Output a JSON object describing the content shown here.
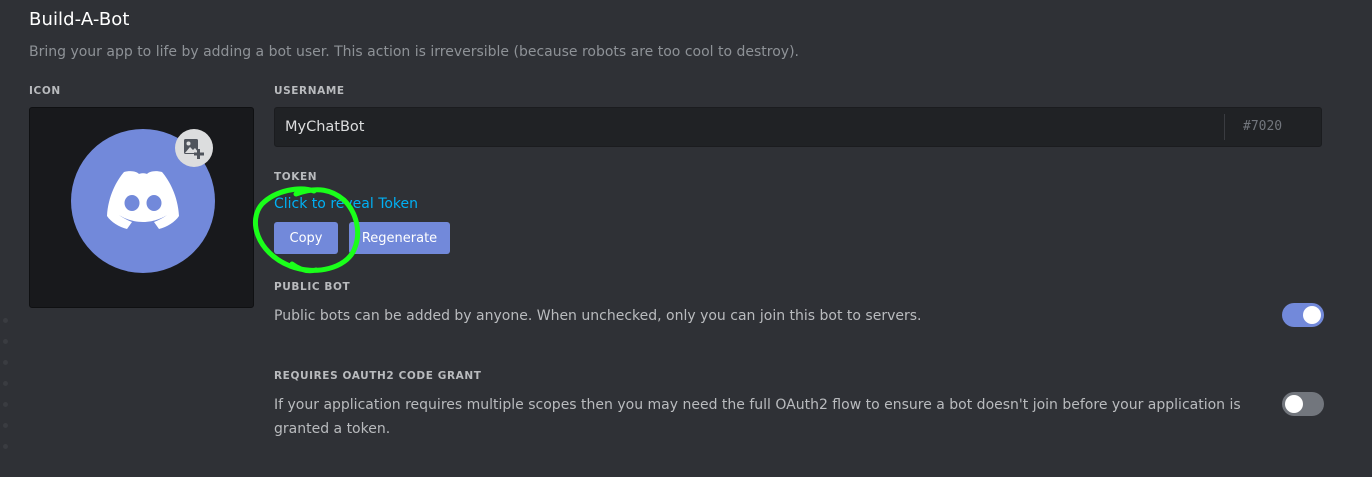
{
  "section": {
    "title": "Build-A-Bot",
    "subtitle": "Bring your app to life by adding a bot user. This action is irreversible (because robots are too cool to destroy)."
  },
  "icon": {
    "label": "ICON",
    "avatar_icon": "discord-logo-icon",
    "upload_icon": "add-image-icon",
    "avatar_color": "#7289da"
  },
  "username": {
    "label": "USERNAME",
    "value": "MyChatBot",
    "discriminator": "#7020"
  },
  "token": {
    "label": "TOKEN",
    "reveal_link": "Click to reveal Token",
    "copy_label": "Copy",
    "regenerate_label": "Regenerate"
  },
  "public_bot": {
    "label": "PUBLIC BOT",
    "description": "Public bots can be added by anyone. When unchecked, only you can join this bot to servers.",
    "enabled": true
  },
  "oauth2_grant": {
    "label": "REQUIRES OAUTH2 CODE GRANT",
    "description": "If your application requires multiple scopes then you may need the full OAuth2 flow to ensure a bot doesn't join before your application is granted a token.",
    "enabled": false
  },
  "colors": {
    "background": "#2f3136",
    "accent": "#7289da",
    "link": "#00b0f4",
    "annotation": "#1aff1a"
  }
}
